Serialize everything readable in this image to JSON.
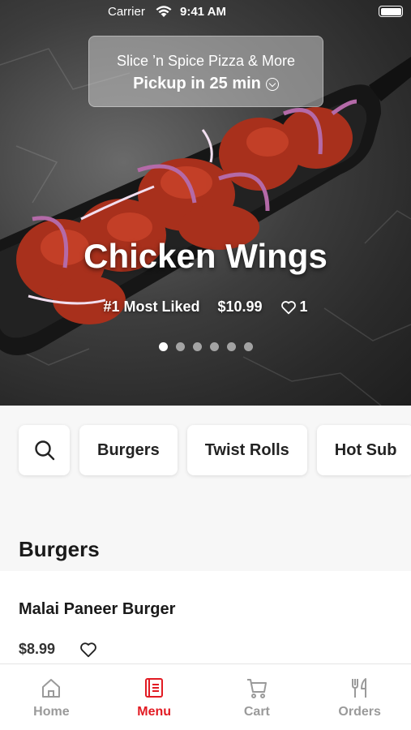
{
  "status_bar": {
    "carrier": "Carrier",
    "time": "9:41 AM"
  },
  "restaurant": {
    "name": "Slice ’n Spice Pizza & More",
    "pickup": "Pickup in 25 min"
  },
  "featured": {
    "title": "Chicken Wings",
    "badge": "#1 Most Liked",
    "price": "$10.99",
    "likes": "1",
    "slide_count": 6,
    "active_slide": 1
  },
  "categories": [
    "Burgers",
    "Twist Rolls",
    "Hot Sub"
  ],
  "section_title": "Burgers",
  "items": [
    {
      "name": "Malai Paneer Burger",
      "price": "$8.99"
    }
  ],
  "tabs": [
    {
      "label": "Home",
      "icon": "home-icon"
    },
    {
      "label": "Menu",
      "icon": "menu-icon",
      "active": true
    },
    {
      "label": "Cart",
      "icon": "cart-icon"
    },
    {
      "label": "Orders",
      "icon": "orders-icon"
    }
  ],
  "colors": {
    "accent": "#e21b23",
    "inactive": "#9a9a9a"
  }
}
